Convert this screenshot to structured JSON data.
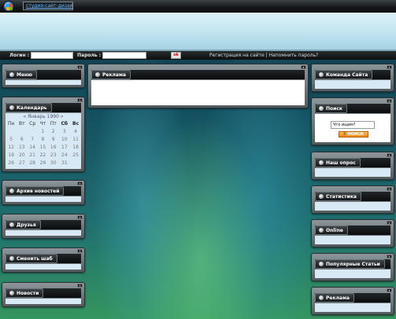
{
  "topbar": {
    "site_link": "студия-сайт-дизайн"
  },
  "login": {
    "login_label": "Логин :",
    "password_label": "Пароль :",
    "ok_label": "ok",
    "register_link": "Регистрация на сайте",
    "separator": "|",
    "remind_link": "Напомнить пароль?"
  },
  "left_blocks": {
    "menu": "Меню",
    "calendar": "Календарь",
    "news_archive": "Архив новостей",
    "friends": "Друзья",
    "change_skin": "Сменить шаб",
    "news": "Новости"
  },
  "center_blocks": {
    "ads": "Реклама"
  },
  "right_blocks": {
    "team": "Команда Сайта",
    "search": "Поиск",
    "poll": "Наш опрос",
    "stats": "Статистика",
    "online": "Online",
    "popular": "Популярные Статьи",
    "ads": "Реклама"
  },
  "calendar": {
    "month": "« Январь 1990 »",
    "weekdays": [
      "Пн",
      "Вт",
      "Ср",
      "Чт",
      "Пт",
      "Сб",
      "Вс"
    ],
    "weeks": [
      [
        "",
        "",
        "",
        "1",
        "2",
        "3",
        "4"
      ],
      [
        "5",
        "6",
        "7",
        "8",
        "9",
        "10",
        "11"
      ],
      [
        "12",
        "13",
        "14",
        "15",
        "16",
        "17",
        "18"
      ],
      [
        "19",
        "20",
        "21",
        "22",
        "23",
        "24",
        "25"
      ],
      [
        "26",
        "27",
        "28",
        "29",
        "30",
        "31",
        ""
      ]
    ]
  },
  "search": {
    "value": "Что ищем?",
    "button": "ПОИСК"
  }
}
